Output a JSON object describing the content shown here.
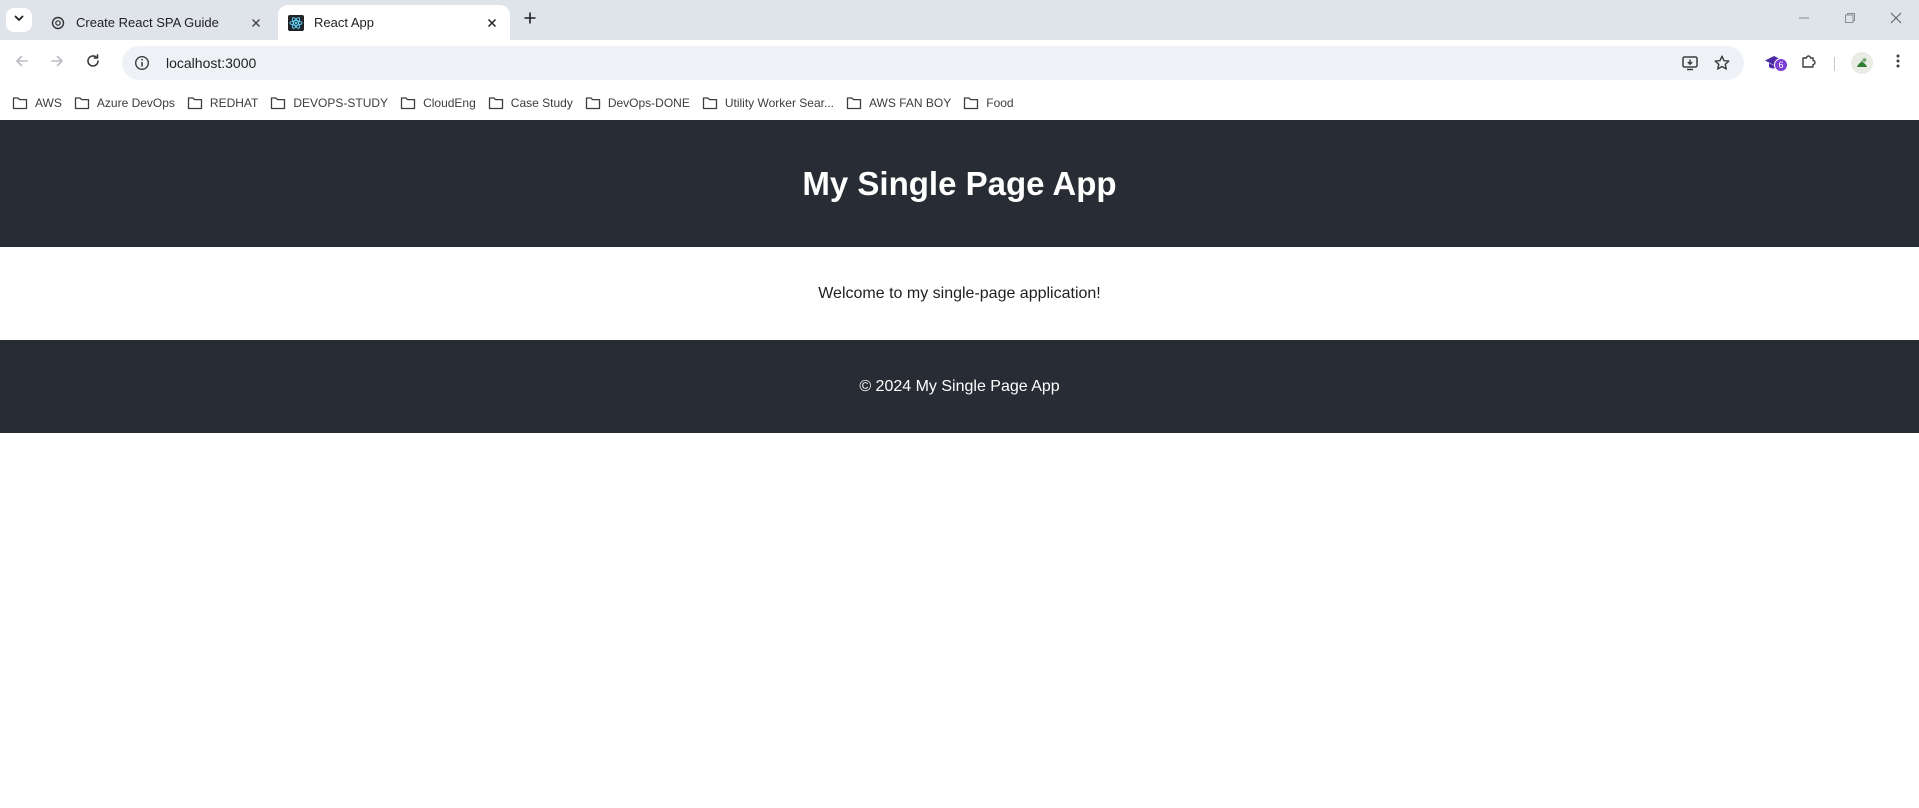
{
  "browser": {
    "tabs": [
      {
        "title": "Create React SPA Guide",
        "icon": "chatgpt-favicon",
        "active": false
      },
      {
        "title": "React App",
        "icon": "react-favicon",
        "active": true
      }
    ],
    "address_bar": {
      "url": "localhost:3000"
    },
    "extension_badge_count": "6",
    "bookmarks": [
      {
        "label": "AWS"
      },
      {
        "label": "Azure DevOps"
      },
      {
        "label": "REDHAT"
      },
      {
        "label": "DEVOPS-STUDY"
      },
      {
        "label": "CloudEng"
      },
      {
        "label": "Case Study"
      },
      {
        "label": "DevOps-DONE"
      },
      {
        "label": "Utility Worker Sear..."
      },
      {
        "label": "AWS FAN BOY"
      },
      {
        "label": "Food"
      }
    ]
  },
  "page": {
    "header_title": "My Single Page App",
    "welcome_text": "Welcome to my single-page application!",
    "footer_text": "© 2024 My Single Page App"
  },
  "colors": {
    "app_dark": "#282c34",
    "tabstrip_bg": "#dfe3ea",
    "omnibox_bg": "#eef1f6",
    "badge_purple": "#7b3fd6"
  }
}
